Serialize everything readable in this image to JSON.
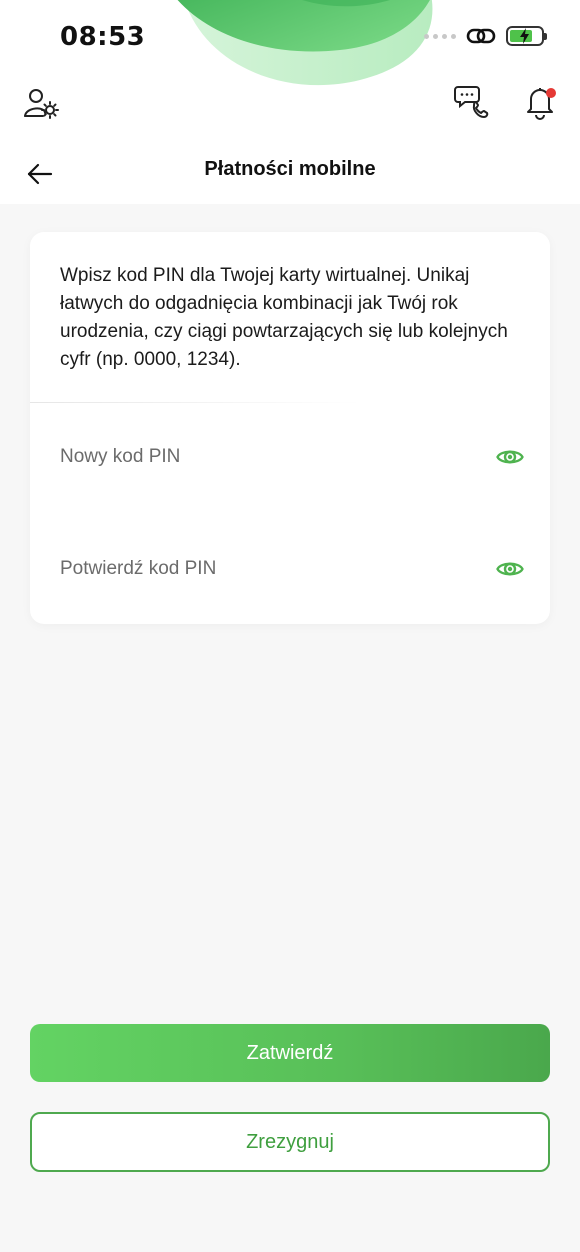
{
  "status_bar": {
    "time": "08:53",
    "battery_level": 0.55,
    "battery_charging": true
  },
  "header": {
    "profile_settings_icon": "user-gear-icon",
    "contact_icon": "chat-phone-icon",
    "notifications_icon": "bell-icon",
    "notification_badge_color": "#e53935"
  },
  "nav": {
    "back_icon": "arrow-left-icon",
    "title": "Płatności mobilne"
  },
  "card": {
    "description": "Wpisz kod PIN dla Twojej karty wirtualnej. Unikaj łatwych do odgadnięcia kombinacji jak Twój rok urodzenia, czy ciągi powtarzających się lub kolejnych cyfr (np. 0000, 1234).",
    "new_pin": {
      "placeholder": "Nowy kod PIN",
      "value": "",
      "toggle_icon": "eye-icon"
    },
    "confirm_pin": {
      "placeholder": "Potwierdź kod PIN",
      "value": "",
      "toggle_icon": "eye-icon"
    }
  },
  "actions": {
    "confirm_label": "Zatwierdź",
    "cancel_label": "Zrezygnuj"
  },
  "colors": {
    "accent": "#58bf58",
    "accent_dark": "#4aa84c",
    "eye_icon": "#4fb34f"
  }
}
